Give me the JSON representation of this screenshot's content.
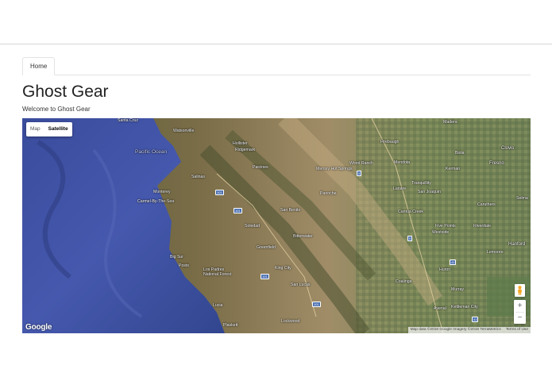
{
  "nav": {
    "tabs": [
      {
        "label": "Home",
        "active": true
      }
    ]
  },
  "page": {
    "title": "Ghost Gear",
    "subtitle": "Welcome to Ghost Gear"
  },
  "map": {
    "type_control": {
      "options": [
        {
          "label": "Map"
        },
        {
          "label": "Satellite"
        }
      ],
      "selected": "Satellite"
    },
    "logo_text": "Google",
    "attribution": {
      "data": "Map data ©2016 Google Imagery ©2016 TerraMetrics",
      "terms": "Terms of Use"
    },
    "zoom": {
      "in": "+",
      "out": "−"
    },
    "places": [
      "Santa Cruz",
      "Watsonville",
      "Pacific Ocean",
      "Hollister",
      "Ridgemark",
      "Salinas",
      "Paicines",
      "Monterey",
      "Carmel-By-The-Sea",
      "Soledad",
      "Mercey Hot Springs",
      "Wood Ranch",
      "Firebaugh",
      "Mendota",
      "Madera",
      "Biola",
      "Clovis",
      "Kerman",
      "Fresno",
      "Tranquillity",
      "Lanare",
      "San Joaquin",
      "Cantua Creek",
      "Caruthers",
      "Selma",
      "Five Points",
      "Westside",
      "Riverdale",
      "Hanford",
      "Lemoore",
      "Panoche",
      "San Benito",
      "Bitterwater",
      "Greenfield",
      "King City",
      "San Lucas",
      "Big Sur",
      "Posts",
      "Los Padres National Forest",
      "Lucia",
      "Plaskett",
      "Lockwood",
      "Coalinga",
      "Huron",
      "Murray",
      "Kettleman City",
      "Avenal"
    ],
    "shields": [
      "101",
      "101",
      "101",
      "101",
      "5",
      "5",
      "41",
      "41"
    ],
    "colors": {
      "ocean": "#3b4fa0",
      "land": "#8a8455",
      "valley": "#7d8a5a"
    }
  }
}
